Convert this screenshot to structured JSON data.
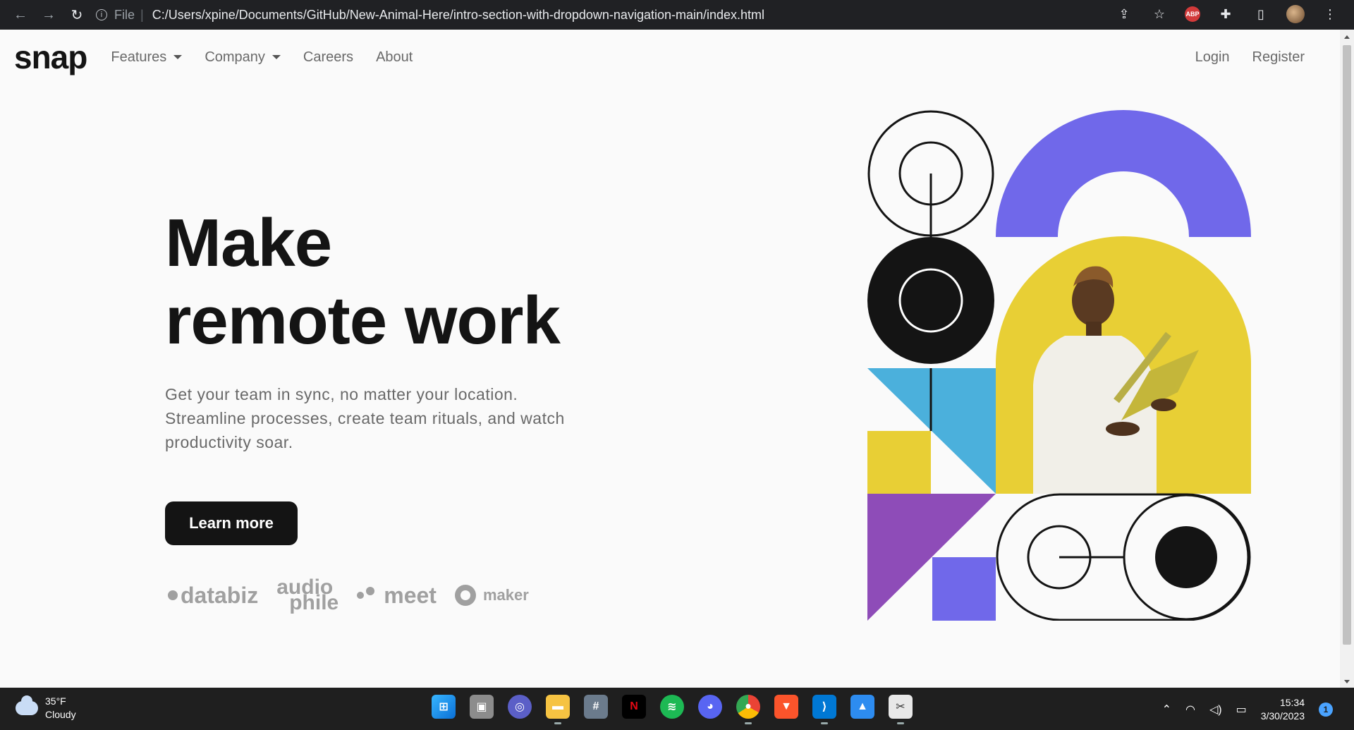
{
  "browser": {
    "file_label": "File",
    "url": "C:/Users/xpine/Documents/GitHub/New-Animal-Here/intro-section-with-dropdown-navigation-main/index.html",
    "abp_label": "ABP"
  },
  "site": {
    "logo": "snap",
    "nav": {
      "features": "Features",
      "company": "Company",
      "careers": "Careers",
      "about": "About",
      "login": "Login",
      "register": "Register"
    },
    "hero": {
      "title_line1": "Make",
      "title_line2": "remote work",
      "description": "Get your team in sync, no matter your location. Streamline processes, create team rituals, and watch productivity soar.",
      "cta": "Learn more"
    },
    "clients": {
      "databiz": "databiz",
      "audiophile_1": "audio",
      "audiophile_2": "phile",
      "meet": "meet",
      "maker": "maker"
    },
    "art_colors": {
      "purple": "#7068ea",
      "yellow": "#e8cf35",
      "blue": "#4bb0dc",
      "violet": "#8e4cb8",
      "black": "#141414"
    }
  },
  "taskbar": {
    "weather_temp": "35°F",
    "weather_desc": "Cloudy",
    "time": "15:34",
    "date": "3/30/2023",
    "notifications": "1",
    "apps": [
      "windows-start",
      "task-view",
      "teams-chat",
      "file-explorer",
      "calculator",
      "netflix",
      "spotify",
      "discord",
      "chrome",
      "brave",
      "vscode",
      "photos",
      "snipping-tool"
    ]
  }
}
